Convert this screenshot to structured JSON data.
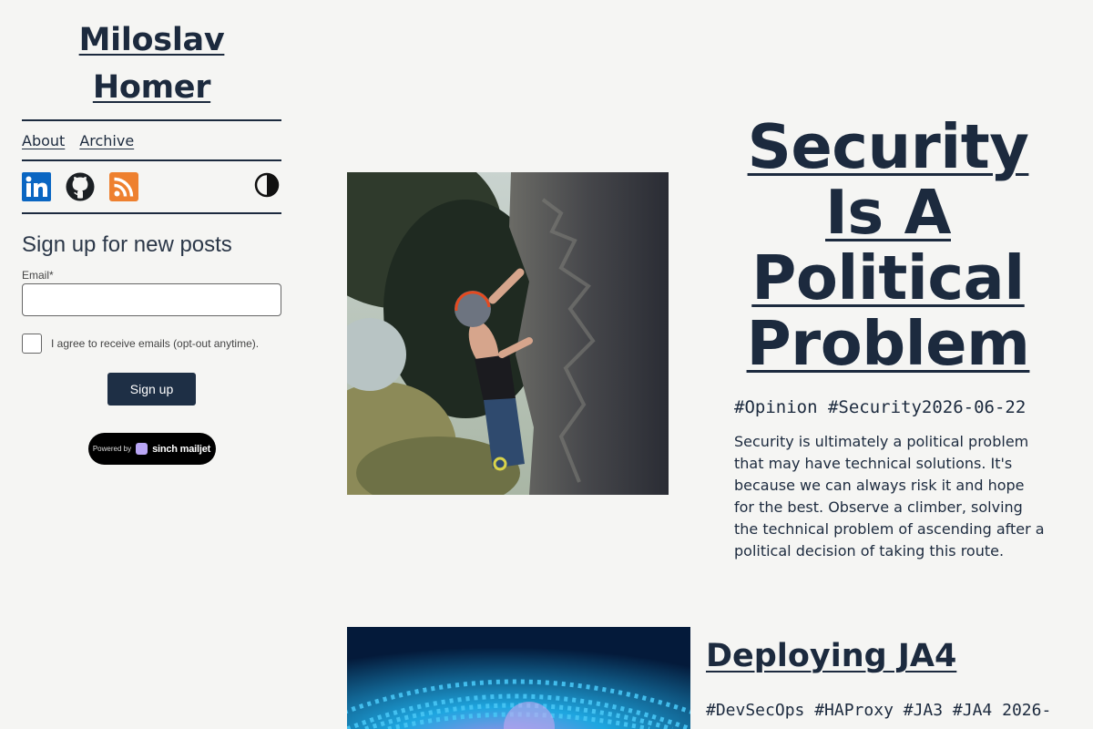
{
  "site": {
    "title": "Miloslav Homer"
  },
  "nav": {
    "about": "About",
    "archive": "Archive"
  },
  "social": {
    "icons": [
      "linkedin-icon",
      "github-icon",
      "rss-icon",
      "theme-toggle-icon"
    ],
    "colors": {
      "linkedin": "#0a66c2",
      "github": "#1b1f23",
      "rss": "#ee802f"
    }
  },
  "signup": {
    "title": "Sign up for new posts",
    "email_label": "Email*",
    "email_value": "",
    "consent_text": "I agree to receive emails (opt-out anytime).",
    "button_label": "Sign up",
    "powered_by": "Powered by",
    "brand": "sinch mailjet"
  },
  "posts": [
    {
      "title": "Security Is A Political Problem",
      "tags": "#Opinion #Security",
      "date": "2026-06-22",
      "meta": "#Opinion #Security2026-06-22",
      "excerpt": "Security is ultimately a political problem that may have technical solutions. It's because we can always risk it and hope for the best. Observe a climber, solving the technical problem of ascending after a political decision of taking this route."
    },
    {
      "title": "Deploying JA4",
      "meta": "#DevSecOps #HAProxy #JA3 #JA4 2026-"
    }
  ],
  "colors": {
    "accent": "#1c2a3e",
    "background": "#f5f5f3",
    "button": "#1e2f45"
  }
}
